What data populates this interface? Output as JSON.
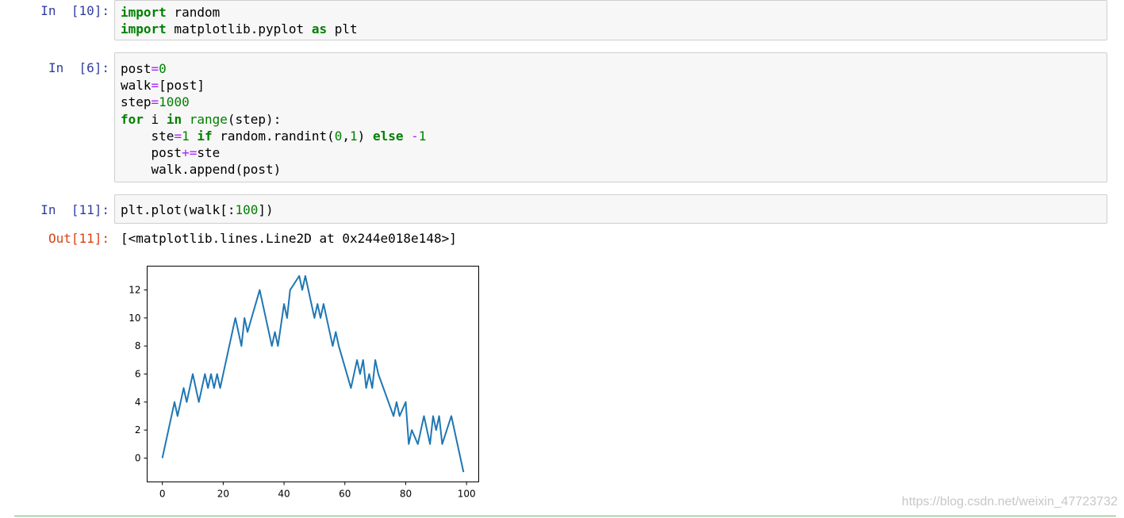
{
  "cells": [
    {
      "prompt": "In  [10]:",
      "lines": [
        [
          {
            "t": "import",
            "c": "kw"
          },
          {
            "t": " random"
          }
        ],
        [
          {
            "t": "import",
            "c": "kw"
          },
          {
            "t": " matplotlib.pyplot "
          },
          {
            "t": "as",
            "c": "kw"
          },
          {
            "t": " plt"
          }
        ]
      ]
    },
    {
      "prompt": "In  [6]:",
      "lines": [
        [
          {
            "t": "post"
          },
          {
            "t": "=",
            "c": "op"
          },
          {
            "t": "0",
            "c": "num"
          }
        ],
        [
          {
            "t": "walk"
          },
          {
            "t": "=",
            "c": "op"
          },
          {
            "t": "[post]"
          }
        ],
        [
          {
            "t": "step"
          },
          {
            "t": "=",
            "c": "op"
          },
          {
            "t": "1000",
            "c": "num"
          }
        ],
        [
          {
            "t": "for",
            "c": "kw"
          },
          {
            "t": " i "
          },
          {
            "t": "in",
            "c": "kw"
          },
          {
            "t": " "
          },
          {
            "t": "range",
            "c": "bi"
          },
          {
            "t": "(step):"
          }
        ],
        [
          {
            "t": "    ste"
          },
          {
            "t": "=",
            "c": "op"
          },
          {
            "t": "1",
            "c": "num"
          },
          {
            "t": " "
          },
          {
            "t": "if",
            "c": "kw"
          },
          {
            "t": " random.randint("
          },
          {
            "t": "0",
            "c": "num"
          },
          {
            "t": ","
          },
          {
            "t": "1",
            "c": "num"
          },
          {
            "t": ") "
          },
          {
            "t": "else",
            "c": "kw"
          },
          {
            "t": " "
          },
          {
            "t": "-",
            "c": "op"
          },
          {
            "t": "1",
            "c": "num"
          }
        ],
        [
          {
            "t": "    post"
          },
          {
            "t": "+=",
            "c": "op"
          },
          {
            "t": "ste"
          }
        ],
        [
          {
            "t": "    walk.append(post)"
          }
        ]
      ]
    },
    {
      "prompt": "In  [11]:",
      "lines": [
        [
          {
            "t": "plt.plot(walk[:"
          },
          {
            "t": "100",
            "c": "num"
          },
          {
            "t": "])"
          }
        ]
      ]
    }
  ],
  "output": {
    "prompt": "Out[11]:",
    "text": "[<matplotlib.lines.Line2D at 0x244e018e148>]"
  },
  "chart_data": {
    "type": "line",
    "title": "",
    "xlabel": "",
    "ylabel": "",
    "xlim": [
      -5,
      104
    ],
    "ylim": [
      -1.7,
      13.7
    ],
    "xticks": [
      0,
      20,
      40,
      60,
      80,
      100
    ],
    "yticks": [
      0,
      2,
      4,
      6,
      8,
      10,
      12
    ],
    "series": [
      {
        "color": "#1f77b4",
        "x": [
          0,
          4,
          5,
          7,
          8,
          10,
          12,
          14,
          15,
          16,
          17,
          18,
          19,
          24,
          26,
          27,
          28,
          32,
          36,
          37,
          38,
          40,
          41,
          42,
          45,
          46,
          47,
          50,
          51,
          52,
          53,
          56,
          57,
          58,
          62,
          64,
          65,
          66,
          67,
          68,
          69,
          70,
          71,
          76,
          77,
          78,
          80,
          81,
          82,
          84,
          86,
          88,
          89,
          90,
          91,
          92,
          95,
          99
        ],
        "y": [
          0,
          4,
          3,
          5,
          4,
          6,
          4,
          6,
          5,
          6,
          5,
          6,
          5,
          10,
          8,
          10,
          9,
          12,
          8,
          9,
          8,
          11,
          10,
          12,
          13,
          12,
          13,
          10,
          11,
          10,
          11,
          8,
          9,
          8,
          5,
          7,
          6,
          7,
          5,
          6,
          5,
          7,
          6,
          3,
          4,
          3,
          4,
          1,
          2,
          1,
          3,
          1,
          3,
          2,
          3,
          1,
          3,
          -1
        ]
      }
    ]
  },
  "watermark": "https://blog.csdn.net/weixin_47723732"
}
